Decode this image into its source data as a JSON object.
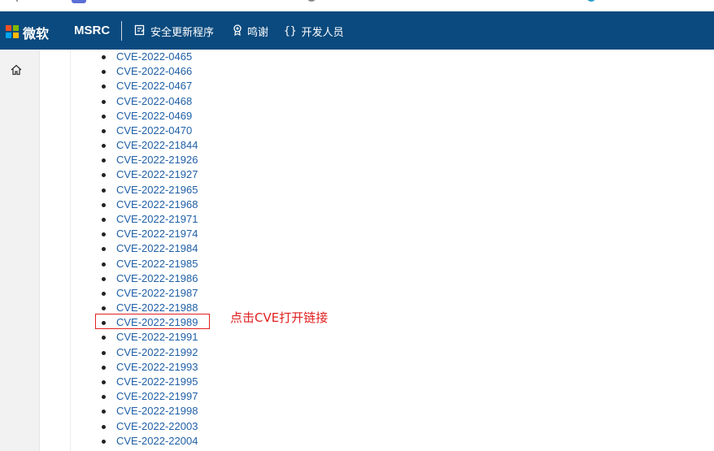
{
  "header": {
    "brand": "微软",
    "site": "MSRC",
    "nav": [
      {
        "label": "安全更新程序",
        "icon": "document-edit-icon"
      },
      {
        "label": "鸣谢",
        "icon": "award-icon"
      },
      {
        "label": "开发人员",
        "icon": "braces-icon"
      }
    ],
    "brand_colors": [
      "#f25022",
      "#7fba00",
      "#00a4ef",
      "#ffb900"
    ],
    "bar_color": "#0b4a7e"
  },
  "sidebar": {
    "home_icon": "home-icon"
  },
  "cve_list": [
    "CVE-2022-0465",
    "CVE-2022-0466",
    "CVE-2022-0467",
    "CVE-2022-0468",
    "CVE-2022-0469",
    "CVE-2022-0470",
    "CVE-2022-21844",
    "CVE-2022-21926",
    "CVE-2022-21927",
    "CVE-2022-21965",
    "CVE-2022-21968",
    "CVE-2022-21971",
    "CVE-2022-21974",
    "CVE-2022-21984",
    "CVE-2022-21985",
    "CVE-2022-21986",
    "CVE-2022-21987",
    "CVE-2022-21988",
    "CVE-2022-21989",
    "CVE-2022-21991",
    "CVE-2022-21992",
    "CVE-2022-21993",
    "CVE-2022-21995",
    "CVE-2022-21997",
    "CVE-2022-21998",
    "CVE-2022-22003",
    "CVE-2022-22004"
  ],
  "annotation": {
    "text": "点击CVE打开链接",
    "highlighted_item": "CVE-2022-21989",
    "color": "#e02020"
  }
}
